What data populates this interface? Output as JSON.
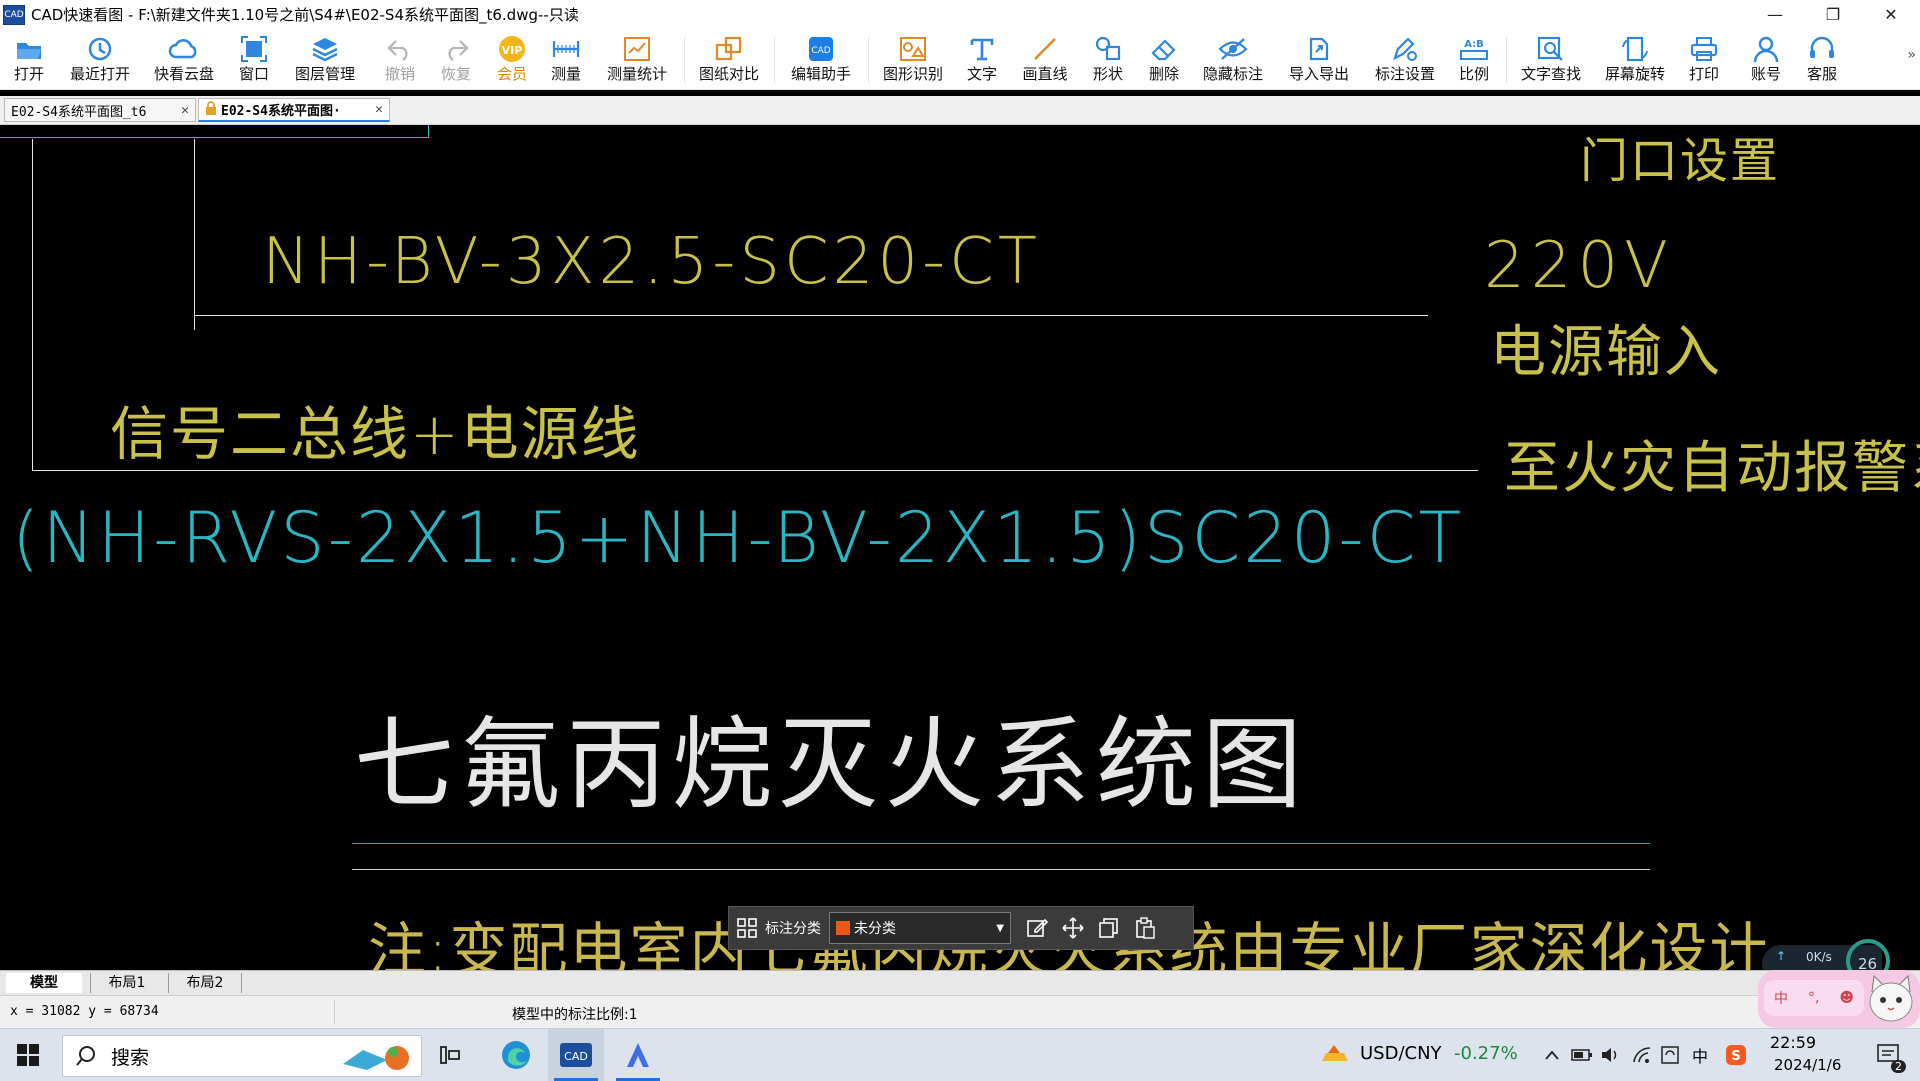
{
  "window": {
    "title": "CAD快速看图 - F:\\新建文件夹1.10号之前\\S4#\\E02-S4系统平面图_t6.dwg--只读",
    "logo_text": "CAD",
    "minimize": "—",
    "restore": "❐",
    "close": "✕"
  },
  "toolbar": {
    "items": [
      {
        "label": "打开",
        "icon": "folder-open-icon"
      },
      {
        "label": "最近打开",
        "icon": "history-icon"
      },
      {
        "label": "快看云盘",
        "icon": "cloud-icon"
      },
      {
        "label": "窗口",
        "icon": "window-icon"
      },
      {
        "label": "图层管理",
        "icon": "layers-icon"
      },
      {
        "label": "撤销",
        "icon": "undo-icon"
      },
      {
        "label": "恢复",
        "icon": "redo-icon"
      },
      {
        "label": "会员",
        "icon": "vip-icon"
      },
      {
        "label": "测量",
        "icon": "ruler-icon"
      },
      {
        "label": "测量统计",
        "icon": "measure-stats-icon"
      },
      {
        "label": "图纸对比",
        "icon": "compare-icon"
      },
      {
        "label": "编辑助手",
        "icon": "edit-assistant-icon"
      },
      {
        "label": "图形识别",
        "icon": "shape-recognize-icon"
      },
      {
        "label": "文字",
        "icon": "text-icon"
      },
      {
        "label": "画直线",
        "icon": "line-icon"
      },
      {
        "label": "形状",
        "icon": "shapes-icon"
      },
      {
        "label": "删除",
        "icon": "eraser-icon"
      },
      {
        "label": "隐藏标注",
        "icon": "eye-hidden-icon"
      },
      {
        "label": "导入导出",
        "icon": "import-export-icon"
      },
      {
        "label": "标注设置",
        "icon": "annotation-settings-icon"
      },
      {
        "label": "比例",
        "icon": "scale-icon"
      },
      {
        "label": "文字查找",
        "icon": "text-search-icon"
      },
      {
        "label": "屏幕旋转",
        "icon": "rotate-screen-icon"
      },
      {
        "label": "打印",
        "icon": "printer-icon"
      },
      {
        "label": "账号",
        "icon": "user-icon"
      },
      {
        "label": "客服",
        "icon": "headset-icon"
      }
    ],
    "more": "»"
  },
  "tabs": [
    {
      "label": "E02-S4系统平面图_t6",
      "close": "✕"
    },
    {
      "label": "E02-S4系统平面图·",
      "close": "✕"
    }
  ],
  "drawing": {
    "texts": {
      "top_right_partial": "门口设置",
      "cable_1": "NH-BV-3X2.5-SC20-CT",
      "voltage": "220V",
      "power_input": "电源输入",
      "signal_bus": "信号二总线+电源线",
      "fire_alarm": "至火灾自动报警系统",
      "cable_2": "(NH-RVS-2X1.5+NH-BV-2X1.5)SC20-CT",
      "heading": "七氟丙烷灭火系统图",
      "note": "注:变配电室内七氟丙烷灭火系统由专业厂家深化设计"
    },
    "colors": {
      "yellow": "#c8c24a",
      "cyan": "#2bb6c4",
      "white": "#e6e6e6",
      "green": "#23b84a",
      "gold": "#c9b84e"
    }
  },
  "annotation_bar": {
    "label": "标注分类",
    "category": "未分类",
    "swatch_color": "#e85a18"
  },
  "net_widget": {
    "upload": "0K/s",
    "percent": "26"
  },
  "layout_tabs": [
    "模型",
    "布局1",
    "布局2"
  ],
  "status": {
    "coords": "x = 31082 y = 68734",
    "scale": "模型中的标注比例:1"
  },
  "pink_widget": {
    "ime": "中",
    "punct": "°,",
    "emoji": "☻"
  },
  "taskbar": {
    "search_placeholder": "搜索",
    "currency": "USD/CNY",
    "change": "-0.27%",
    "time": "22:59",
    "date": "2024/1/6",
    "ime_indicator": "中",
    "notify_count": "2"
  }
}
